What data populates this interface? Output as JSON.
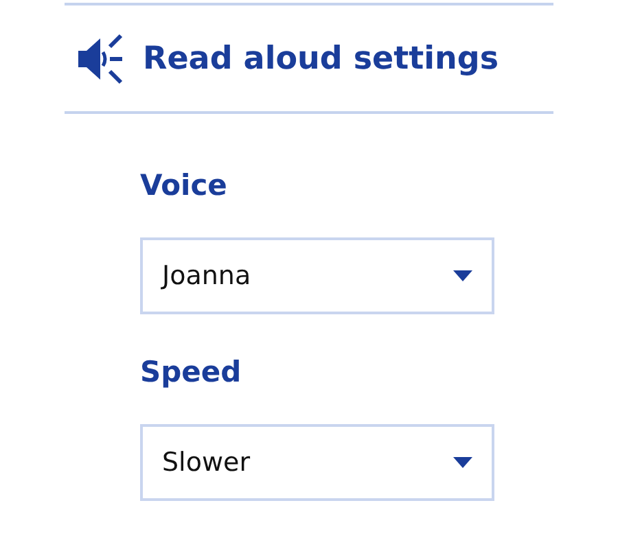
{
  "header": {
    "title": "Read aloud settings"
  },
  "fields": [
    {
      "label": "Voice",
      "value": "Joanna"
    },
    {
      "label": "Speed",
      "value": "Slower"
    }
  ]
}
